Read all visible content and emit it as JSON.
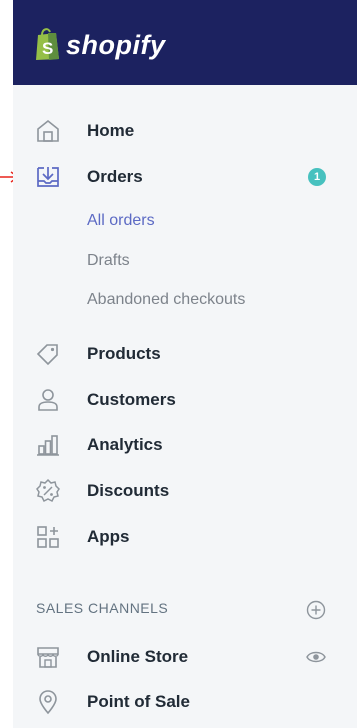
{
  "brand": {
    "name": "shopify"
  },
  "nav": [
    {
      "label": "Home",
      "icon": "home-icon"
    },
    {
      "label": "Orders",
      "icon": "orders-icon",
      "badge": "1"
    },
    {
      "label": "Products",
      "icon": "tag-icon"
    },
    {
      "label": "Customers",
      "icon": "person-icon"
    },
    {
      "label": "Analytics",
      "icon": "bar-chart-icon"
    },
    {
      "label": "Discounts",
      "icon": "discount-icon"
    },
    {
      "label": "Apps",
      "icon": "apps-icon"
    }
  ],
  "orders_sub": [
    {
      "label": "All orders",
      "active": true
    },
    {
      "label": "Drafts"
    },
    {
      "label": "Abandoned checkouts"
    }
  ],
  "sales_channels": {
    "title": "SALES CHANNELS",
    "items": [
      {
        "label": "Online Store",
        "icon": "store-icon"
      },
      {
        "label": "Point of Sale",
        "icon": "location-pin-icon"
      }
    ]
  },
  "colors": {
    "topbar": "#1c2260",
    "sidebar_bg": "#f4f6f8",
    "badge": "#47c1bf",
    "active_link": "#5c6ac4",
    "arrow": "#e8241c"
  }
}
